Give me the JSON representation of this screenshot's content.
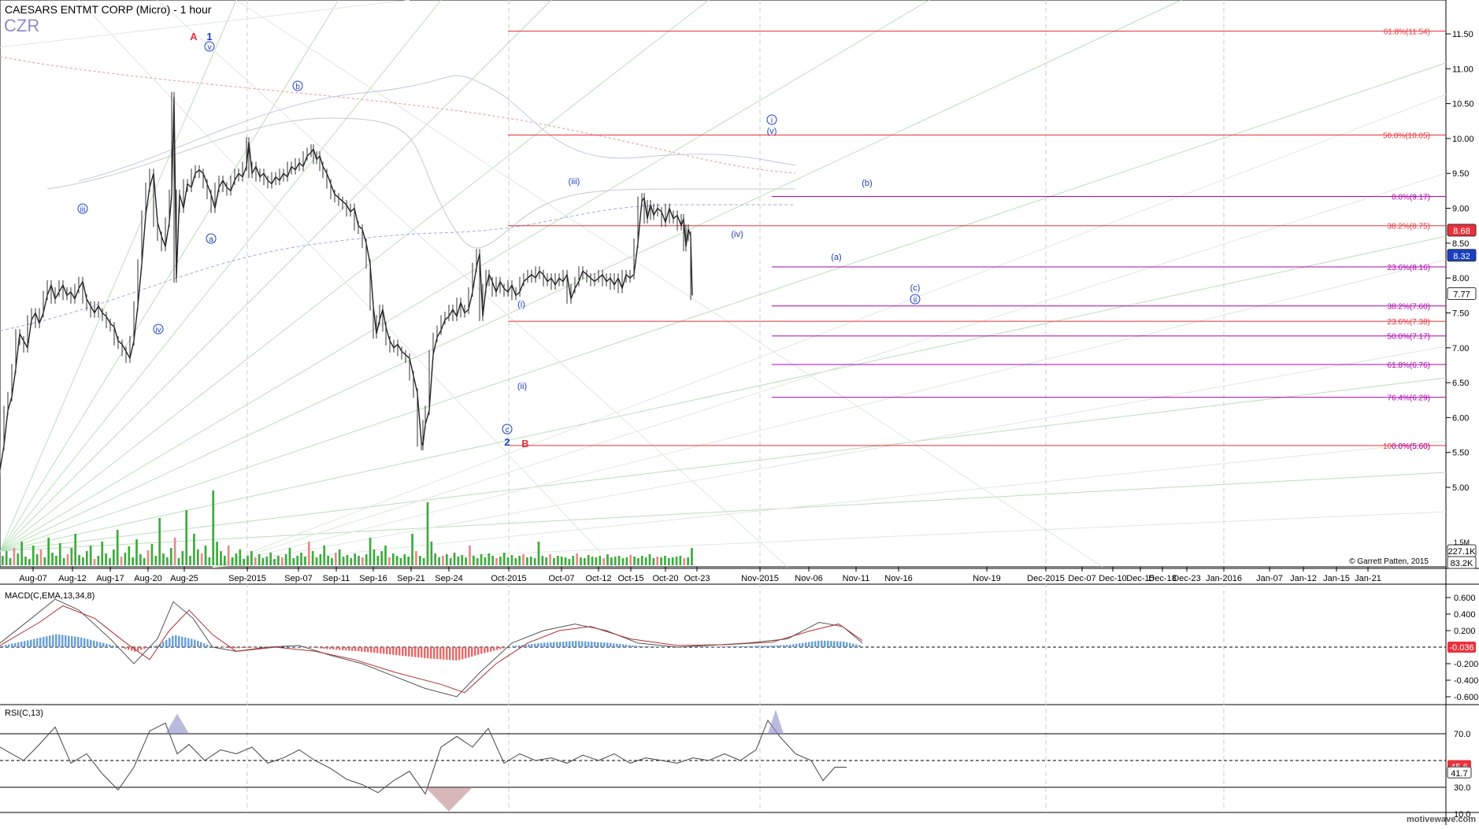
{
  "header": {
    "title": "CAESARS ENTMT CORP (Micro) - 1 hour",
    "symbol": "CZR"
  },
  "chart_data": [
    {
      "type": "line",
      "name": "price",
      "yticks": [
        "11.50",
        "11.00",
        "10.50",
        "10.00",
        "9.50",
        "9.00",
        "8.50",
        "8.00",
        "7.50",
        "7.00",
        "6.50",
        "6.00",
        "5.50",
        "5.00"
      ],
      "ylim": [
        4.55,
        11.6
      ],
      "xlabels": [
        "Aug-07",
        "Aug-12",
        "Aug-17",
        "Aug-20",
        "Aug-25",
        "Sep-2015",
        "Sep-07",
        "Sep-11",
        "Sep-16",
        "Sep-21",
        "Sep-24",
        "Oct-2015",
        "Oct-07",
        "Oct-12",
        "Oct-15",
        "Oct-20",
        "Oct-23",
        "Nov-2015",
        "Nov-06",
        "Nov-11",
        "Nov-16",
        "Nov-19",
        "Dec-2015",
        "Dec-07",
        "Dec-10",
        "Dec-15",
        "Dec-18",
        "Dec-23",
        "Jan-2016",
        "Jan-07",
        "Jan-12",
        "Jan-15",
        "Jan-21"
      ],
      "price_path": [
        [
          0,
          5.25
        ],
        [
          5,
          5.6
        ],
        [
          10,
          6.1
        ],
        [
          15,
          6.3
        ],
        [
          20,
          6.7
        ],
        [
          25,
          7.2
        ],
        [
          30,
          7.1
        ],
        [
          35,
          7.0
        ],
        [
          40,
          7.4
        ],
        [
          45,
          7.5
        ],
        [
          50,
          7.35
        ],
        [
          55,
          7.5
        ],
        [
          60,
          7.75
        ],
        [
          65,
          7.9
        ],
        [
          70,
          7.7
        ],
        [
          75,
          7.8
        ],
        [
          80,
          7.9
        ],
        [
          85,
          7.75
        ],
        [
          90,
          7.8
        ],
        [
          95,
          7.7
        ],
        [
          100,
          7.85
        ],
        [
          105,
          7.95
        ],
        [
          110,
          7.7
        ],
        [
          115,
          7.6
        ],
        [
          120,
          7.5
        ],
        [
          125,
          7.6
        ],
        [
          130,
          7.5
        ],
        [
          135,
          7.45
        ],
        [
          140,
          7.35
        ],
        [
          145,
          7.3
        ],
        [
          150,
          7.1
        ],
        [
          155,
          7.05
        ],
        [
          160,
          6.95
        ],
        [
          165,
          6.85
        ],
        [
          170,
          7.1
        ],
        [
          175,
          7.6
        ],
        [
          180,
          8.2
        ],
        [
          185,
          8.9
        ],
        [
          190,
          9.3
        ],
        [
          195,
          9.5
        ],
        [
          200,
          8.8
        ],
        [
          205,
          8.6
        ],
        [
          210,
          8.45
        ],
        [
          215,
          8.8
        ],
        [
          218,
          9.2
        ],
        [
          221,
          10.6
        ],
        [
          224,
          8.0
        ],
        [
          228,
          9.2
        ],
        [
          233,
          9.0
        ],
        [
          238,
          9.35
        ],
        [
          243,
          9.3
        ],
        [
          248,
          9.5
        ],
        [
          253,
          9.55
        ],
        [
          258,
          9.5
        ],
        [
          263,
          9.35
        ],
        [
          268,
          9.2
        ],
        [
          273,
          9.0
        ],
        [
          278,
          9.3
        ],
        [
          283,
          9.4
        ],
        [
          288,
          9.3
        ],
        [
          293,
          9.25
        ],
        [
          298,
          9.4
        ],
        [
          303,
          9.5
        ],
        [
          308,
          9.45
        ],
        [
          313,
          9.6
        ],
        [
          316,
          9.95
        ],
        [
          320,
          9.5
        ],
        [
          325,
          9.6
        ],
        [
          330,
          9.45
        ],
        [
          335,
          9.5
        ],
        [
          340,
          9.4
        ],
        [
          345,
          9.35
        ],
        [
          350,
          9.45
        ],
        [
          355,
          9.4
        ],
        [
          360,
          9.5
        ],
        [
          365,
          9.45
        ],
        [
          370,
          9.6
        ],
        [
          375,
          9.55
        ],
        [
          380,
          9.65
        ],
        [
          385,
          9.6
        ],
        [
          390,
          9.75
        ],
        [
          395,
          9.8
        ],
        [
          398,
          9.85
        ],
        [
          402,
          9.7
        ],
        [
          406,
          9.75
        ],
        [
          410,
          9.6
        ],
        [
          415,
          9.5
        ],
        [
          420,
          9.35
        ],
        [
          425,
          9.2
        ],
        [
          430,
          9.15
        ],
        [
          435,
          9.1
        ],
        [
          440,
          9.05
        ],
        [
          445,
          8.95
        ],
        [
          450,
          9.0
        ],
        [
          455,
          8.75
        ],
        [
          460,
          8.7
        ],
        [
          465,
          8.5
        ],
        [
          470,
          8.2
        ],
        [
          474,
          7.6
        ],
        [
          478,
          7.2
        ],
        [
          482,
          7.4
        ],
        [
          486,
          7.55
        ],
        [
          490,
          7.3
        ],
        [
          495,
          7.1
        ],
        [
          500,
          7.0
        ],
        [
          505,
          7.05
        ],
        [
          510,
          6.95
        ],
        [
          515,
          6.9
        ],
        [
          520,
          6.85
        ],
        [
          525,
          6.6
        ],
        [
          530,
          6.35
        ],
        [
          535,
          5.65
        ],
        [
          537,
          5.6
        ],
        [
          540,
          5.9
        ],
        [
          545,
          6.1
        ],
        [
          550,
          6.9
        ],
        [
          555,
          7.15
        ],
        [
          560,
          7.25
        ],
        [
          565,
          7.4
        ],
        [
          570,
          7.45
        ],
        [
          575,
          7.55
        ],
        [
          580,
          7.45
        ],
        [
          585,
          7.65
        ],
        [
          590,
          7.5
        ],
        [
          595,
          7.55
        ],
        [
          600,
          7.8
        ],
        [
          605,
          8.15
        ],
        [
          609,
          8.35
        ],
        [
          613,
          7.45
        ],
        [
          617,
          7.85
        ],
        [
          621,
          8.05
        ],
        [
          625,
          7.95
        ],
        [
          630,
          7.8
        ],
        [
          635,
          7.95
        ],
        [
          640,
          7.85
        ],
        [
          645,
          7.8
        ],
        [
          650,
          7.9
        ],
        [
          655,
          7.75
        ],
        [
          660,
          7.8
        ],
        [
          665,
          7.95
        ],
        [
          670,
          8.0
        ],
        [
          675,
          8.05
        ],
        [
          680,
          8.0
        ],
        [
          685,
          8.1
        ],
        [
          690,
          8.05
        ],
        [
          695,
          7.95
        ],
        [
          700,
          8.0
        ],
        [
          705,
          7.9
        ],
        [
          710,
          8.0
        ],
        [
          715,
          7.95
        ],
        [
          720,
          8.05
        ],
        [
          725,
          7.7
        ],
        [
          730,
          7.85
        ],
        [
          735,
          7.95
        ],
        [
          740,
          8.1
        ],
        [
          745,
          8.05
        ],
        [
          750,
          8.0
        ],
        [
          755,
          7.95
        ],
        [
          760,
          8.0
        ],
        [
          765,
          8.05
        ],
        [
          770,
          7.95
        ],
        [
          775,
          8.0
        ],
        [
          780,
          7.9
        ],
        [
          785,
          8.0
        ],
        [
          790,
          7.85
        ],
        [
          795,
          8.05
        ],
        [
          800,
          8.0
        ],
        [
          805,
          8.05
        ],
        [
          810,
          8.5
        ],
        [
          815,
          9.1
        ],
        [
          818,
          9.15
        ],
        [
          822,
          8.85
        ],
        [
          826,
          9.05
        ],
        [
          830,
          8.9
        ],
        [
          835,
          9.0
        ],
        [
          840,
          8.95
        ],
        [
          845,
          8.8
        ],
        [
          850,
          9.0
        ],
        [
          855,
          8.85
        ],
        [
          860,
          8.9
        ],
        [
          865,
          8.75
        ],
        [
          868,
          8.85
        ],
        [
          871,
          8.45
        ],
        [
          874,
          8.7
        ],
        [
          877,
          8.6
        ],
        [
          879,
          7.75
        ]
      ],
      "volume_heights": [
        12,
        18,
        9,
        22,
        15,
        30,
        11,
        8,
        25,
        14,
        20,
        10,
        35,
        16,
        12,
        28,
        9,
        14,
        22,
        40,
        13,
        10,
        18,
        25,
        8,
        12,
        30,
        15,
        9,
        20,
        45,
        11,
        16,
        24,
        10,
        33,
        14,
        9,
        19,
        27,
        12,
        60,
        15,
        10,
        22,
        35,
        9,
        18,
        70,
        12,
        40,
        20,
        15,
        25,
        10,
        95,
        30,
        18,
        12,
        25,
        10,
        15,
        20,
        8,
        12,
        18,
        10,
        14,
        9,
        11,
        16,
        8,
        12,
        10,
        14,
        22,
        9,
        12,
        16,
        11,
        30,
        18,
        10,
        14,
        25,
        12,
        9,
        16,
        20,
        11,
        13,
        9,
        15,
        12,
        10,
        14,
        35,
        20,
        12,
        18,
        25,
        10,
        15,
        12,
        9,
        14,
        11,
        40,
        18,
        12,
        9,
        80,
        30,
        15,
        10,
        12,
        14,
        9,
        16,
        11,
        13,
        10,
        25,
        12,
        9,
        14,
        10,
        15,
        12,
        9,
        11,
        16,
        10,
        13,
        9,
        12,
        14,
        10,
        11,
        9,
        30,
        12,
        10,
        14,
        9,
        12,
        11,
        10,
        8,
        12,
        15,
        10,
        9,
        13,
        11,
        10,
        12,
        9,
        14,
        10,
        11,
        12,
        9,
        10,
        13,
        11,
        9,
        12,
        10,
        14,
        9,
        11,
        10,
        12,
        9,
        10,
        11,
        12,
        9,
        10,
        22
      ]
    },
    {
      "type": "line",
      "name": "MACD",
      "label": "MACD(C,EMA,13,34,8)",
      "yticks": [
        "0.600",
        "0.400",
        "0.200",
        "-0.200",
        "-0.400",
        "-0.600"
      ],
      "ylim": [
        -0.75,
        0.7
      ],
      "current": "-0.036"
    },
    {
      "type": "line",
      "name": "RSI",
      "label": "RSI(C,13)",
      "yticks": [
        "70.0",
        "30.0",
        "10.0"
      ],
      "ylim": [
        5,
        100
      ],
      "current": "41.7",
      "marker": "45.6"
    }
  ],
  "price_tags": {
    "last": "8.68",
    "p2": "8.32",
    "p3": "7.77",
    "vol1": "227.1K",
    "vol2": "83.2K",
    "vol_top": "1.5M"
  },
  "fib_red": [
    {
      "label": "61.8%(11.54)",
      "value": 11.54
    },
    {
      "label": "50.0%(10.05)",
      "value": 10.05
    },
    {
      "label": "38.2%(8.75)",
      "value": 8.75
    },
    {
      "label": "23.6%(7.38)",
      "value": 7.38
    },
    {
      "label": "100.0%(5.60)",
      "value": 5.6
    }
  ],
  "fib_magenta": [
    {
      "label": "0.0%(9.17)",
      "value": 9.17
    },
    {
      "label": "23.6%(8.16)",
      "value": 8.16
    },
    {
      "label": "38.2%(7.60)",
      "value": 7.6
    },
    {
      "label": "50.0%(7.17)",
      "value": 7.17
    },
    {
      "label": "61.8%(6.76)",
      "value": 6.76
    },
    {
      "label": "76.4%(6.29)",
      "value": 6.29
    }
  ],
  "fib_magenta_overlap": {
    "label": "0.0%(5.60)",
    "value": 5.6
  },
  "wave_labels": {
    "A": "A",
    "B": "B",
    "one": "1",
    "two": "2",
    "v_circle": "v",
    "a_circle": "a",
    "b_circle": "b",
    "c_circle": "c",
    "iii_circle": "iii",
    "iv_circle": "iv",
    "i_paren": "(i)",
    "ii_paren": "(ii)",
    "iii_paren": "(iii)",
    "iv_paren": "(iv)",
    "v_paren": "(v)",
    "i_circle": "i",
    "ii_circle": "ii",
    "a_paren": "(a)",
    "b_paren": "(b)",
    "c_paren": "(c)"
  },
  "copyright": "© Garrett Patten, 2015",
  "watermark": "motivewave.com",
  "colors": {
    "red": "#e8323c",
    "magenta": "#b000b0",
    "blue": "#1a3fc0",
    "volume": "#3caa3c",
    "macd_up": "#6a9fd8",
    "macd_down": "#e86a6a",
    "rsi_fill_hi": "#8c8cc8",
    "rsi_fill_lo": "#b07070"
  }
}
